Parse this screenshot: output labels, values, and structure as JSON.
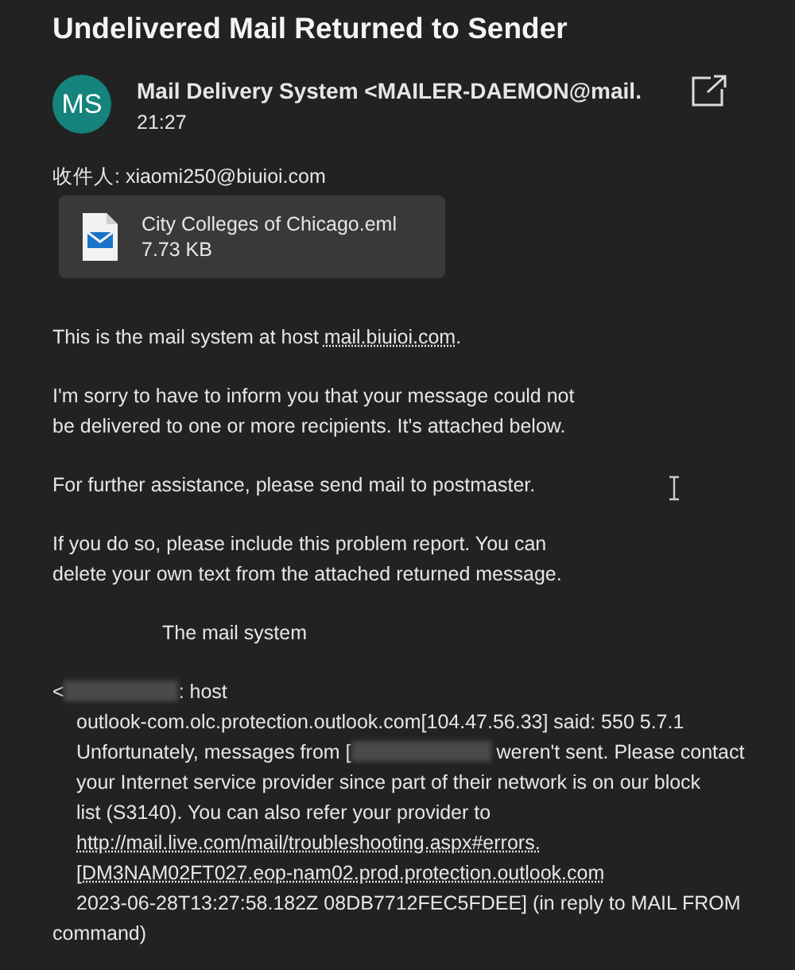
{
  "title": "Undelivered Mail Returned to Sender",
  "sender": {
    "initials": "MS",
    "name": "Mail Delivery System <MAILER-DAEMON@mail.",
    "time": "21:27"
  },
  "recipient": "收件人: xiaomi250@biuioi.com",
  "attachment": {
    "name": "City Colleges of Chicago.eml",
    "size": "7.73 KB"
  },
  "body": [
    {
      "kind": "text",
      "lines": [
        {
          "kind": "plain",
          "segments": [
            {
              "kind": "text",
              "text": "This is the mail system at host "
            },
            {
              "kind": "link",
              "text": "mail.biuioi.com"
            },
            {
              "kind": "text",
              "text": "."
            }
          ]
        }
      ]
    },
    {
      "kind": "text",
      "lines": [
        {
          "kind": "plain",
          "segments": [
            {
              "kind": "text",
              "text": "I'm sorry to have to inform you that your message could not"
            }
          ]
        },
        {
          "kind": "plain",
          "segments": [
            {
              "kind": "text",
              "text": "be delivered to one or more recipients. It's attached below."
            }
          ]
        }
      ]
    },
    {
      "kind": "text",
      "lines": [
        {
          "kind": "plain",
          "segments": [
            {
              "kind": "text",
              "text": "For further assistance, please send mail to postmaster."
            }
          ]
        }
      ]
    },
    {
      "kind": "text",
      "lines": [
        {
          "kind": "plain",
          "segments": [
            {
              "kind": "text",
              "text": "If you do so, please include this problem report. You can"
            }
          ]
        },
        {
          "kind": "plain",
          "segments": [
            {
              "kind": "text",
              "text": "delete your own text from the attached returned message."
            }
          ]
        }
      ]
    },
    {
      "kind": "signature",
      "lines": [
        {
          "kind": "plain",
          "segments": [
            {
              "kind": "text",
              "text": "The mail system"
            }
          ]
        }
      ]
    },
    {
      "kind": "text",
      "lines": [
        {
          "kind": "plain",
          "segments": [
            {
              "kind": "text",
              "text": "<"
            },
            {
              "kind": "redacted"
            },
            {
              "kind": "text",
              "text": ": host"
            }
          ]
        },
        {
          "kind": "indented",
          "segments": [
            {
              "kind": "text",
              "text": "outlook-com.olc.protection.outlook.com[104.47.56.33] said: 550 5.7.1"
            }
          ]
        },
        {
          "kind": "indented",
          "segments": [
            {
              "kind": "text",
              "text": "Unfortunately, messages from ["
            },
            {
              "kind": "redacted"
            },
            {
              "kind": "text",
              "text": " weren't sent. Please contact"
            }
          ]
        },
        {
          "kind": "indented",
          "segments": [
            {
              "kind": "text",
              "text": "your Internet service provider since part of their network is on our block"
            }
          ]
        },
        {
          "kind": "indented",
          "segments": [
            {
              "kind": "text",
              "text": "list (S3140). You can also refer your provider to"
            }
          ]
        },
        {
          "kind": "indented",
          "segments": [
            {
              "kind": "link",
              "text": "http://mail.live.com/mail/troubleshooting.aspx#errors."
            }
          ]
        },
        {
          "kind": "indented",
          "segments": [
            {
              "kind": "link",
              "text": "[DM3NAM02FT027.eop-nam02.prod.protection.outlook.com"
            }
          ]
        },
        {
          "kind": "indented",
          "segments": [
            {
              "kind": "text",
              "text": "2023-06-28T13:27:58.182Z 08DB7712FEC5FDEE] (in reply to MAIL FROM"
            }
          ]
        },
        {
          "kind": "plain",
          "segments": [
            {
              "kind": "text",
              "text": "command)"
            }
          ]
        }
      ]
    }
  ]
}
